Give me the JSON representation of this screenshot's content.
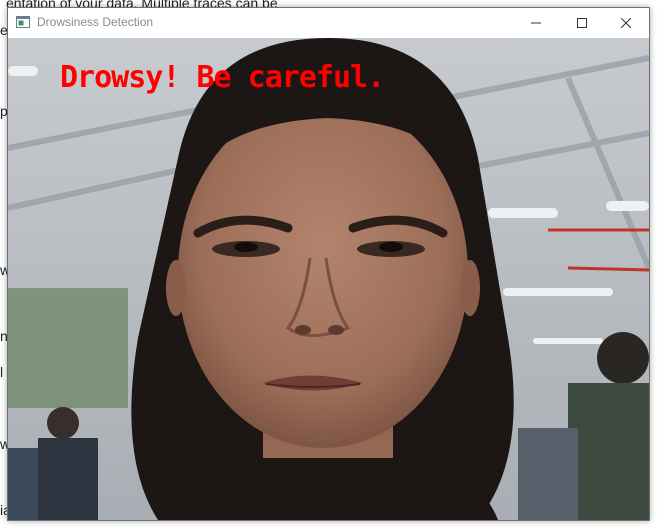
{
  "background_document": {
    "top_line": "entation of your data. Multiple traces can be",
    "fragments": [
      "e",
      "p",
      "w",
      "n",
      "l",
      "w",
      "ia"
    ]
  },
  "window": {
    "title": "Drowsiness Detection",
    "controls": {
      "minimize": "minimize",
      "maximize": "maximize",
      "close": "close"
    }
  },
  "video_feed": {
    "alert_text": "Drowsy! Be careful.",
    "alert_color": "#ff0000"
  }
}
